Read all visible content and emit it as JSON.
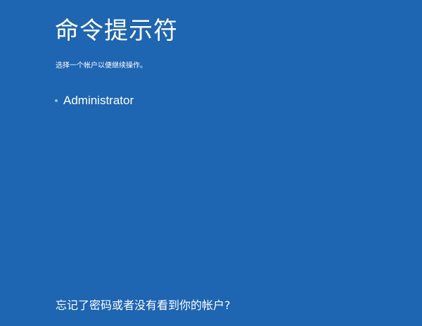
{
  "header": {
    "title": "命令提示符",
    "subtitle": "选择一个帐户以便继续操作。"
  },
  "accounts": [
    {
      "label": "Administrator"
    }
  ],
  "footer": {
    "forgot_link": "忘记了密码或者没有看到你的帐户?"
  },
  "colors": {
    "background": "#1e65b2",
    "text": "#ffffff",
    "bullet": "#8fc0ec"
  },
  "icons": {
    "bullet": "dot-icon"
  }
}
